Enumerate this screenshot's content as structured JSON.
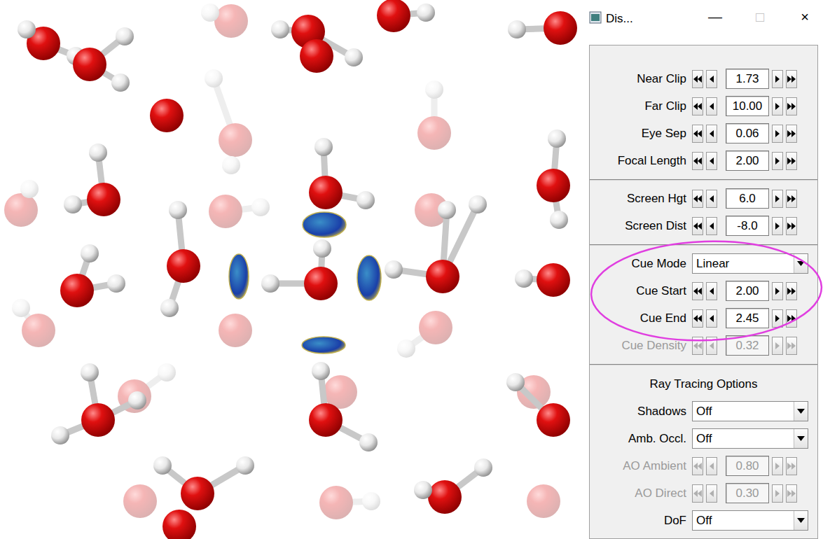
{
  "window": {
    "title": "Dis...",
    "controls": [
      {
        "glyph": "—",
        "disabled": false
      },
      {
        "glyph": "□",
        "disabled": true
      },
      {
        "glyph": "×",
        "disabled": false
      }
    ]
  },
  "groups": [
    {
      "rows": [
        {
          "kind": "spinner",
          "label": "Near Clip",
          "value": "1.73",
          "disabled": false,
          "circled": false
        },
        {
          "kind": "spinner",
          "label": "Far Clip",
          "value": "10.00",
          "disabled": false,
          "circled": false
        },
        {
          "kind": "spinner",
          "label": "Eye Sep",
          "value": "0.06",
          "disabled": false,
          "circled": false
        },
        {
          "kind": "spinner",
          "label": "Focal Length",
          "value": "2.00",
          "disabled": false,
          "circled": false
        }
      ]
    },
    {
      "rows": [
        {
          "kind": "spinner",
          "label": "Screen Hgt",
          "value": "6.0",
          "disabled": false,
          "circled": false
        },
        {
          "kind": "spinner",
          "label": "Screen Dist",
          "value": "-8.0",
          "disabled": false,
          "circled": false
        }
      ]
    },
    {
      "rows": [
        {
          "kind": "dropdown",
          "label": "Cue Mode",
          "value": "Linear",
          "disabled": false,
          "circled": true
        },
        {
          "kind": "spinner",
          "label": "Cue Start",
          "value": "2.00",
          "disabled": false,
          "circled": true
        },
        {
          "kind": "spinner",
          "label": "Cue End",
          "value": "2.45",
          "disabled": false,
          "circled": true
        },
        {
          "kind": "spinner",
          "label": "Cue Density",
          "value": "0.32",
          "disabled": true,
          "circled": false
        }
      ]
    },
    {
      "title": "Ray Tracing Options",
      "rows": [
        {
          "kind": "dropdown",
          "label": "Shadows",
          "value": "Off",
          "disabled": false,
          "circled": false
        },
        {
          "kind": "dropdown",
          "label": "Amb. Occl.",
          "value": "Off",
          "disabled": false,
          "circled": false
        },
        {
          "kind": "spinner",
          "label": "AO Ambient",
          "value": "0.80",
          "disabled": true,
          "circled": false
        },
        {
          "kind": "spinner",
          "label": "AO Direct",
          "value": "0.30",
          "disabled": true,
          "circled": false
        },
        {
          "kind": "dropdown",
          "label": "DoF",
          "value": "Off",
          "disabled": false,
          "circled": false
        }
      ]
    }
  ]
}
